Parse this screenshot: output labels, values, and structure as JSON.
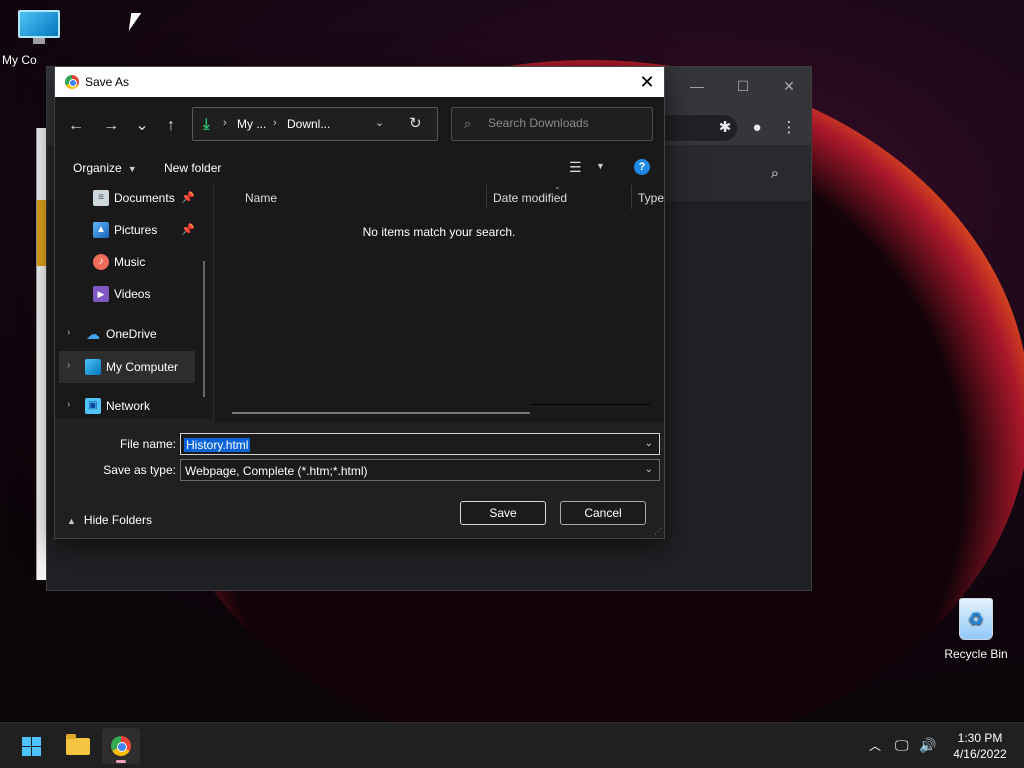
{
  "desktop": {
    "icons": [
      {
        "label": "My Co"
      },
      {
        "label": "Recycle Bin"
      }
    ]
  },
  "browser": {
    "window_controls": {
      "minimize": "—",
      "maximize": "☐",
      "close": "✕"
    }
  },
  "dialog": {
    "title": "Save As",
    "close_glyph": "✕",
    "nav": {
      "back": "←",
      "forward": "→",
      "recent": "⌄",
      "up": "↑"
    },
    "address": {
      "segments": [
        "My ...",
        "Downl..."
      ],
      "separator": "›",
      "dropdown": "⌄",
      "refresh": "↻"
    },
    "search": {
      "placeholder": "Search Downloads"
    },
    "commands": {
      "organize": "Organize",
      "new_folder": "New folder"
    },
    "nav_pane": [
      {
        "label": "Documents",
        "icon": "documents-icon",
        "pinned": true
      },
      {
        "label": "Pictures",
        "icon": "pictures-icon",
        "pinned": true
      },
      {
        "label": "Music",
        "icon": "music-icon",
        "pinned": false
      },
      {
        "label": "Videos",
        "icon": "videos-icon",
        "pinned": false
      },
      {
        "label": "OneDrive",
        "icon": "onedrive-icon",
        "expandable": true
      },
      {
        "label": "My Computer",
        "icon": "computer-icon",
        "expandable": true,
        "selected": true
      },
      {
        "label": "Network",
        "icon": "network-icon",
        "expandable": true
      }
    ],
    "columns": [
      "Name",
      "Date modified",
      "Type"
    ],
    "empty_message": "No items match your search.",
    "file_name_label": "File name:",
    "file_name_value": "History.html",
    "save_type_label": "Save as type:",
    "save_type_value": "Webpage, Complete (*.htm;*.html)",
    "hide_folders": "Hide Folders",
    "save_button": "Save",
    "cancel_button": "Cancel"
  },
  "taskbar": {
    "clock_time": "1:30 PM",
    "clock_date": "4/16/2022",
    "colors": {
      "accent": "#4cc2ff",
      "selection": "#0a64d8"
    }
  }
}
